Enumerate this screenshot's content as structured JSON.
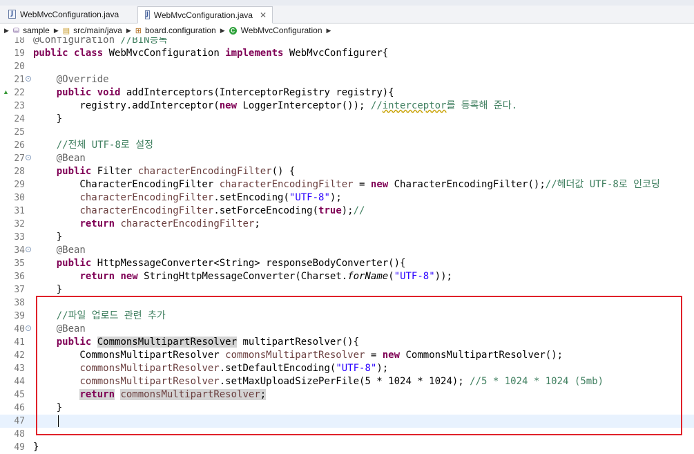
{
  "tabs": [
    {
      "label": "WebMvcConfiguration.java",
      "active": false
    },
    {
      "label": "WebMvcConfiguration.java",
      "active": true,
      "close": "✕"
    }
  ],
  "breadcrumb": [
    {
      "label": "sample",
      "icon": "project-icon"
    },
    {
      "label": "src/main/java",
      "icon": "source-folder-icon"
    },
    {
      "label": "board.configuration",
      "icon": "package-icon"
    },
    {
      "label": "WebMvcConfiguration",
      "icon": "class-icon"
    }
  ],
  "colors": {
    "keyword": "#7f0055",
    "comment": "#3f7f5f",
    "string": "#2a00ff",
    "annotation": "#646464",
    "field": "#6a3e3e",
    "highlight_box": "#e0212a",
    "current_line": "#e8f2fe"
  },
  "lines": [
    {
      "n": "18",
      "code": "@Configuration //BIN등록"
    },
    {
      "n": "19",
      "code": "public class WebMvcConfiguration implements WebMvcConfigurer{"
    },
    {
      "n": "20",
      "code": ""
    },
    {
      "n": "21",
      "code": "    @Override",
      "fold": true
    },
    {
      "n": "22",
      "code": "    public void addInterceptors(InterceptorRegistry registry){",
      "marker": true
    },
    {
      "n": "23",
      "code": "        registry.addInterceptor(new LoggerInterceptor()); //interceptor를 등록해 준다."
    },
    {
      "n": "24",
      "code": "    }"
    },
    {
      "n": "25",
      "code": ""
    },
    {
      "n": "26",
      "code": "    //전체 UTF-8로 설정"
    },
    {
      "n": "27",
      "code": "    @Bean",
      "fold": true
    },
    {
      "n": "28",
      "code": "    public Filter characterEncodingFilter() {"
    },
    {
      "n": "29",
      "code": "        CharacterEncodingFilter characterEncodingFilter = new CharacterEncodingFilter();//헤더값 UTF-8로 인코딩"
    },
    {
      "n": "30",
      "code": "        characterEncodingFilter.setEncoding(\"UTF-8\");"
    },
    {
      "n": "31",
      "code": "        characterEncodingFilter.setForceEncoding(true);//"
    },
    {
      "n": "32",
      "code": "        return characterEncodingFilter;"
    },
    {
      "n": "33",
      "code": "    }"
    },
    {
      "n": "34",
      "code": "    @Bean",
      "fold": true
    },
    {
      "n": "35",
      "code": "    public HttpMessageConverter<String> responseBodyConverter(){"
    },
    {
      "n": "36",
      "code": "        return new StringHttpMessageConverter(Charset.forName(\"UTF-8\"));"
    },
    {
      "n": "37",
      "code": "    }"
    },
    {
      "n": "38",
      "code": ""
    },
    {
      "n": "39",
      "code": "    //파일 업로드 관련 추가"
    },
    {
      "n": "40",
      "code": "    @Bean",
      "fold": true
    },
    {
      "n": "41",
      "code": "    public CommonsMultipartResolver multipartResolver(){"
    },
    {
      "n": "42",
      "code": "        CommonsMultipartResolver commonsMultipartResolver = new CommonsMultipartResolver();"
    },
    {
      "n": "43",
      "code": "        commonsMultipartResolver.setDefaultEncoding(\"UTF-8\");"
    },
    {
      "n": "44",
      "code": "        commonsMultipartResolver.setMaxUploadSizePerFile(5 * 1024 * 1024); //5 * 1024 * 1024 (5mb)"
    },
    {
      "n": "45",
      "code": "        return commonsMultipartResolver;"
    },
    {
      "n": "46",
      "code": "    }"
    },
    {
      "n": "47",
      "code": "    ",
      "current": true
    },
    {
      "n": "48",
      "code": ""
    },
    {
      "n": "49",
      "code": "}"
    }
  ]
}
